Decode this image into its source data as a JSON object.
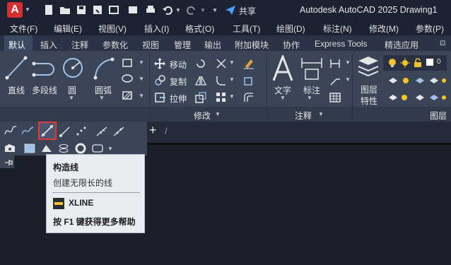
{
  "titlebar": {
    "app_logo_letter": "A",
    "share_label": "共享",
    "title": "Autodesk AutoCAD 2025    Drawing1"
  },
  "menu": {
    "items": [
      "文件(F)",
      "编辑(E)",
      "视图(V)",
      "插入(I)",
      "格式(O)",
      "工具(T)",
      "绘图(D)",
      "标注(N)",
      "修改(M)",
      "参数(P)"
    ]
  },
  "ribbon_tabs": {
    "items": [
      "默认",
      "插入",
      "注释",
      "参数化",
      "视图",
      "管理",
      "输出",
      "附加模块",
      "协作",
      "Express Tools",
      "精选应用"
    ]
  },
  "draw_panel": {
    "line": "直线",
    "polyline": "多段线",
    "circle": "圆",
    "arc": "圆弧"
  },
  "modify_panel": {
    "move": "移动",
    "copy": "复制",
    "stretch": "拉伸",
    "title": "修改"
  },
  "annotation_panel": {
    "text": "文字",
    "dimension": "标注",
    "title": "注释"
  },
  "layers_panel": {
    "layer_properties_line1": "图层",
    "layer_properties_line2": "特性",
    "title": "图层"
  },
  "file_tab": {
    "plus": "+",
    "slash": "/"
  },
  "tooltip": {
    "title": "构造线",
    "description": "创建无限长的线",
    "command": "XLINE",
    "help": "按 F1 键获得更多帮助"
  },
  "colors": {
    "accent_red": "#e23a3a",
    "share_blue": "#4aa3ff",
    "bulb_yellow": "#f2c230"
  }
}
